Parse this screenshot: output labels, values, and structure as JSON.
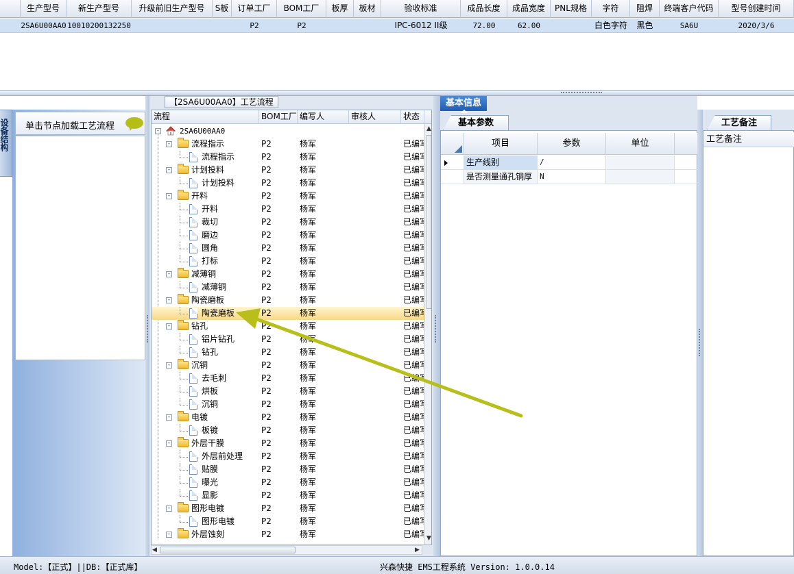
{
  "top_grid": {
    "columns": [
      "生产型号",
      "新生产型号",
      "升级前旧生产型号",
      "S板",
      "订单工厂",
      "BOM工厂",
      "板厚",
      "板材",
      "验收标准",
      "成品长度",
      "成品宽度",
      "PNL规格",
      "字符",
      "阻焊",
      "终端客户代码",
      "型号创建时间"
    ],
    "row": [
      "2SA6U00AA0",
      "10010200132250",
      "",
      "",
      "P2",
      "P2",
      "",
      "",
      "IPC-6012 II级",
      "72.00",
      "62.00",
      "",
      "白色字符",
      "黑色",
      "SA6U",
      "2020/3/6"
    ]
  },
  "sidebar": {
    "vertical_tab": "设备结构",
    "hint": "单击节点加载工艺流程",
    "hint_icon": "speech-bubble-icon"
  },
  "process_panel": {
    "title": "【2SA6U00AA0】工艺流程",
    "columns": [
      "流程",
      "BOM工厂",
      "编写人",
      "审核人",
      "状态"
    ],
    "root": "2SA6U00AA0",
    "rows": [
      {
        "name": "流程指示",
        "level": 1,
        "type": "folder",
        "bom": "P2",
        "author": "杨军",
        "reviewer": "",
        "status": "已编写"
      },
      {
        "name": "流程指示",
        "level": 2,
        "type": "doc",
        "bom": "P2",
        "author": "杨军",
        "reviewer": "",
        "status": "已编写"
      },
      {
        "name": "计划投料",
        "level": 1,
        "type": "folder",
        "bom": "P2",
        "author": "杨军",
        "reviewer": "",
        "status": "已编写"
      },
      {
        "name": "计划投料",
        "level": 2,
        "type": "doc",
        "bom": "P2",
        "author": "杨军",
        "reviewer": "",
        "status": "已编写"
      },
      {
        "name": "开料",
        "level": 1,
        "type": "folder",
        "bom": "P2",
        "author": "杨军",
        "reviewer": "",
        "status": "已编写"
      },
      {
        "name": "开料",
        "level": 2,
        "type": "doc",
        "bom": "P2",
        "author": "杨军",
        "reviewer": "",
        "status": "已编写"
      },
      {
        "name": "裁切",
        "level": 2,
        "type": "doc",
        "bom": "P2",
        "author": "杨军",
        "reviewer": "",
        "status": "已编写"
      },
      {
        "name": "磨边",
        "level": 2,
        "type": "doc",
        "bom": "P2",
        "author": "杨军",
        "reviewer": "",
        "status": "已编写"
      },
      {
        "name": "圆角",
        "level": 2,
        "type": "doc",
        "bom": "P2",
        "author": "杨军",
        "reviewer": "",
        "status": "已编写"
      },
      {
        "name": "打标",
        "level": 2,
        "type": "doc",
        "bom": "P2",
        "author": "杨军",
        "reviewer": "",
        "status": "已编写"
      },
      {
        "name": "减薄铜",
        "level": 1,
        "type": "folder",
        "bom": "P2",
        "author": "杨军",
        "reviewer": "",
        "status": "已编写"
      },
      {
        "name": "减薄铜",
        "level": 2,
        "type": "doc",
        "bom": "P2",
        "author": "杨军",
        "reviewer": "",
        "status": "已编写"
      },
      {
        "name": "陶瓷磨板",
        "level": 1,
        "type": "folder",
        "bom": "P2",
        "author": "杨军",
        "reviewer": "",
        "status": "已编写"
      },
      {
        "name": "陶瓷磨板",
        "level": 2,
        "type": "doc",
        "bom": "P2",
        "author": "杨军",
        "reviewer": "",
        "status": "已编写",
        "selected": true
      },
      {
        "name": "钻孔",
        "level": 1,
        "type": "folder",
        "bom": "P2",
        "author": "杨军",
        "reviewer": "",
        "status": "已编写"
      },
      {
        "name": "铝片钻孔",
        "level": 2,
        "type": "doc",
        "bom": "P2",
        "author": "杨军",
        "reviewer": "",
        "status": "已编写"
      },
      {
        "name": "钻孔",
        "level": 2,
        "type": "doc",
        "bom": "P2",
        "author": "杨军",
        "reviewer": "",
        "status": "已编写"
      },
      {
        "name": "沉铜",
        "level": 1,
        "type": "folder",
        "bom": "P2",
        "author": "杨军",
        "reviewer": "",
        "status": "已编写"
      },
      {
        "name": "去毛刺",
        "level": 2,
        "type": "doc",
        "bom": "P2",
        "author": "杨军",
        "reviewer": "",
        "status": "已编写"
      },
      {
        "name": "烘板",
        "level": 2,
        "type": "doc",
        "bom": "P2",
        "author": "杨军",
        "reviewer": "",
        "status": "已编写"
      },
      {
        "name": "沉铜",
        "level": 2,
        "type": "doc",
        "bom": "P2",
        "author": "杨军",
        "reviewer": "",
        "status": "已编写"
      },
      {
        "name": "电镀",
        "level": 1,
        "type": "folder",
        "bom": "P2",
        "author": "杨军",
        "reviewer": "",
        "status": "已编写"
      },
      {
        "name": "板镀",
        "level": 2,
        "type": "doc",
        "bom": "P2",
        "author": "杨军",
        "reviewer": "",
        "status": "已编写"
      },
      {
        "name": "外层干膜",
        "level": 1,
        "type": "folder",
        "bom": "P2",
        "author": "杨军",
        "reviewer": "",
        "status": "已编写"
      },
      {
        "name": "外层前处理",
        "level": 2,
        "type": "doc",
        "bom": "P2",
        "author": "杨军",
        "reviewer": "",
        "status": "已编写"
      },
      {
        "name": "贴膜",
        "level": 2,
        "type": "doc",
        "bom": "P2",
        "author": "杨军",
        "reviewer": "",
        "status": "已编写"
      },
      {
        "name": "曝光",
        "level": 2,
        "type": "doc",
        "bom": "P2",
        "author": "杨军",
        "reviewer": "",
        "status": "已编写"
      },
      {
        "name": "显影",
        "level": 2,
        "type": "doc",
        "bom": "P2",
        "author": "杨军",
        "reviewer": "",
        "status": "已编写"
      },
      {
        "name": "图形电镀",
        "level": 1,
        "type": "folder",
        "bom": "P2",
        "author": "杨军",
        "reviewer": "",
        "status": "已编写"
      },
      {
        "name": "图形电镀",
        "level": 2,
        "type": "doc",
        "bom": "P2",
        "author": "杨军",
        "reviewer": "",
        "status": "已编写"
      },
      {
        "name": "外层蚀刻",
        "level": 1,
        "type": "folder",
        "bom": "P2",
        "author": "杨军",
        "reviewer": "",
        "status": "已编写"
      }
    ]
  },
  "info_panel": {
    "tab": "基本信息",
    "sub_tab": "基本参数",
    "columns": [
      "项目",
      "参数",
      "单位"
    ],
    "rows": [
      {
        "item": "生产线别",
        "param": "/",
        "unit": ""
      },
      {
        "item": "是否测量通孔铜厚",
        "param": "N",
        "unit": ""
      }
    ]
  },
  "remark_panel": {
    "tab": "工艺备注",
    "header": "工艺备注"
  },
  "status_bar": {
    "left": "Model:【正式】||DB:【正式库】",
    "center": "兴森快捷 EMS工程系统 Version: 1.0.0.14"
  },
  "annotation": {
    "color": "#b8bf1a"
  }
}
